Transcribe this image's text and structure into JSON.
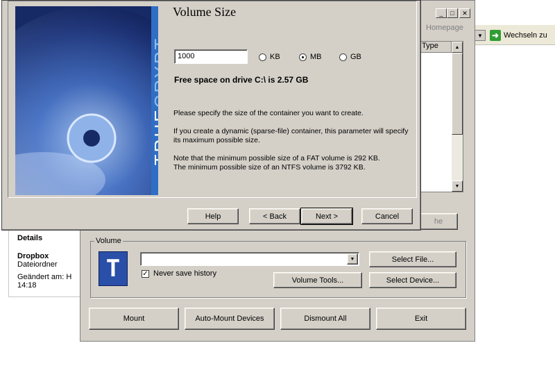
{
  "explorer": {
    "go_label": "Wechseln zu",
    "go_icon": "arrow-right-icon",
    "details": {
      "title": "Details",
      "name": "Dropbox",
      "type": "Dateiordner",
      "modified": "Geändert am: Heut",
      "time": "14:18"
    }
  },
  "truecrypt": {
    "homepage": "Homepage",
    "drive_list": {
      "type_header": "Type"
    },
    "wipe_cache": "he",
    "volume": {
      "group_label": "Volume",
      "path_value": "",
      "never_save_history": "Never save history",
      "never_save_checked": true,
      "select_file": "Select File...",
      "volume_tools": "Volume Tools...",
      "select_device": "Select Device..."
    },
    "actions": {
      "mount": "Mount",
      "auto_mount": "Auto-Mount Devices",
      "dismount_all": "Dismount All",
      "exit": "Exit"
    }
  },
  "wizard": {
    "brand_true": "TRUE",
    "brand_crypt": "CRYPT",
    "title": "Volume Size",
    "size_value": "1000",
    "units": [
      {
        "label": "KB",
        "selected": false
      },
      {
        "label": "MB",
        "selected": true
      },
      {
        "label": "GB",
        "selected": false
      }
    ],
    "free_space": "Free space on drive C:\\ is 2.57 GB",
    "info1": "Please specify the size of the container you want to create.",
    "info2": "If you create a dynamic (sparse-file) container, this parameter will specify its maximum possible size.",
    "info3a": "Note that the minimum possible size of a FAT volume is 292 KB.",
    "info3b": "The minimum possible size of an NTFS volume is 3792 KB.",
    "buttons": {
      "help": "Help",
      "back": "< Back",
      "next": "Next >",
      "cancel": "Cancel"
    }
  },
  "colors": {
    "brand_blue": "#2f6ec4",
    "dialog_gray": "#d4d0c8"
  }
}
